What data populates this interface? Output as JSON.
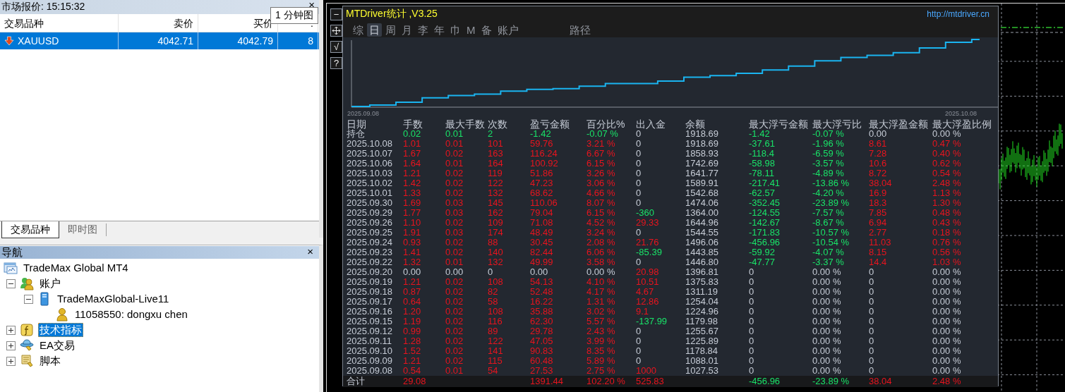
{
  "market_watch": {
    "title": "市场报价: 15:15:32",
    "close": "×",
    "tooltip": "1 分钟图",
    "columns": [
      "交易品种",
      "卖价",
      "买价",
      ":"
    ],
    "rows": [
      {
        "symbol": "XAUUSD",
        "price_down": true,
        "bid": "4042.71",
        "ask": "4042.79",
        "column_4": "8",
        "selected": true
      }
    ],
    "tabs": [
      {
        "label": "交易品种",
        "selected": true
      },
      {
        "label": "即时图",
        "selected": false
      }
    ]
  },
  "navigator": {
    "title": "导航",
    "close": "×",
    "tree": [
      {
        "label": "TradeMax Global MT4",
        "kind": "terminal",
        "selected": false,
        "children": [
          {
            "label": "账户",
            "kind": "accounts",
            "expanded": true,
            "selected": false,
            "children": [
              {
                "label": "TradeMaxGlobal-Live11",
                "kind": "server",
                "expanded": true,
                "selected": false,
                "children": [
                  {
                    "label": "11058550: dongxu chen",
                    "kind": "account",
                    "selected": false
                  }
                ]
              }
            ]
          },
          {
            "label": "技术指标",
            "kind": "indicators",
            "expanded": false,
            "selected": true
          },
          {
            "label": "EA交易",
            "kind": "experts",
            "expanded": false,
            "selected": false
          },
          {
            "label": "脚本",
            "kind": "scripts",
            "expanded": false,
            "selected": false
          }
        ]
      }
    ]
  },
  "chart_window": {
    "toolbar": [
      {
        "kind": "glyph",
        "label": "−"
      },
      {
        "kind": "move"
      },
      {
        "kind": "glyph",
        "label": "√"
      },
      {
        "kind": "glyph",
        "label": "?"
      }
    ]
  },
  "stats_panel": {
    "title": "MTDriver统计 ,V3.25",
    "link": "http://mtdriver.cn",
    "tabs": [
      {
        "label": "综",
        "selected": false
      },
      {
        "label": "日",
        "selected": true
      },
      {
        "label": "周",
        "selected": false
      },
      {
        "label": "月",
        "selected": false
      },
      {
        "label": "李",
        "selected": false
      },
      {
        "label": "年",
        "selected": false
      },
      {
        "label": "巾",
        "selected": false
      },
      {
        "label": "M",
        "selected": false
      },
      {
        "label": "备",
        "selected": false
      },
      {
        "label": "账户",
        "selected": false
      },
      {
        "label": "路径",
        "selected": false
      }
    ],
    "chart": {
      "start_label": "2025.09.08",
      "end_label": "2025.10.08"
    },
    "table": {
      "columns": [
        "日期",
        "手数",
        "最大手数",
        "次数",
        "盈亏金额",
        "百分比%",
        "出入金",
        "余额",
        "最大浮亏金额",
        "最大浮亏比",
        "最大浮盈金额",
        "最大浮盈比例"
      ],
      "rows": [
        {
          "cells": [
            {
              "text": "持仓",
              "color": "#c6ccd6"
            },
            {
              "text": "0.02",
              "color": "#19e368"
            },
            {
              "text": "0.01",
              "color": "#19e368"
            },
            {
              "text": "2",
              "color": "#19e368"
            },
            {
              "text": "-1.42",
              "color": "#19e368"
            },
            {
              "text": "-0.07 %",
              "color": "#19e368"
            },
            {
              "text": "0",
              "color": "#c6ccd6"
            },
            {
              "text": "1918.69",
              "color": "#c6ccd6"
            },
            {
              "text": "-1.42",
              "color": "#19e368"
            },
            {
              "text": "-0.07 %",
              "color": "#19e368"
            },
            {
              "text": "0.00",
              "color": "#c6ccd6"
            },
            {
              "text": "0.00 %",
              "color": "#c6ccd6"
            }
          ]
        },
        {
          "cells": [
            {
              "text": "2025.10.08",
              "color": "#c6ccd6"
            },
            {
              "text": "1.01",
              "color": "#e8141e"
            },
            {
              "text": "0.01",
              "color": "#e8141e"
            },
            {
              "text": "101",
              "color": "#e8141e"
            },
            {
              "text": "59.76",
              "color": "#e8141e"
            },
            {
              "text": "3.21 %",
              "color": "#e8141e"
            },
            {
              "text": "0",
              "color": "#c6ccd6"
            },
            {
              "text": "1918.69",
              "color": "#c6ccd6"
            },
            {
              "text": "-37.61",
              "color": "#19e368"
            },
            {
              "text": "-1.96 %",
              "color": "#19e368"
            },
            {
              "text": "8.61",
              "color": "#e8141e"
            },
            {
              "text": "0.47 %",
              "color": "#e8141e"
            }
          ]
        },
        {
          "cells": [
            {
              "text": "2025.10.07",
              "color": "#c6ccd6"
            },
            {
              "text": "1.67",
              "color": "#e8141e"
            },
            {
              "text": "0.02",
              "color": "#e8141e"
            },
            {
              "text": "163",
              "color": "#e8141e"
            },
            {
              "text": "116.24",
              "color": "#e8141e"
            },
            {
              "text": "6.67 %",
              "color": "#e8141e"
            },
            {
              "text": "0",
              "color": "#c6ccd6"
            },
            {
              "text": "1858.93",
              "color": "#c6ccd6"
            },
            {
              "text": "-118.4",
              "color": "#19e368"
            },
            {
              "text": "-6.59 %",
              "color": "#19e368"
            },
            {
              "text": "7.28",
              "color": "#e8141e"
            },
            {
              "text": "0.40 %",
              "color": "#e8141e"
            }
          ]
        },
        {
          "cells": [
            {
              "text": "2025.10.06",
              "color": "#c6ccd6"
            },
            {
              "text": "1.64",
              "color": "#e8141e"
            },
            {
              "text": "0.01",
              "color": "#e8141e"
            },
            {
              "text": "164",
              "color": "#e8141e"
            },
            {
              "text": "100.92",
              "color": "#e8141e"
            },
            {
              "text": "6.15 %",
              "color": "#e8141e"
            },
            {
              "text": "0",
              "color": "#c6ccd6"
            },
            {
              "text": "1742.69",
              "color": "#c6ccd6"
            },
            {
              "text": "-58.98",
              "color": "#19e368"
            },
            {
              "text": "-3.57 %",
              "color": "#19e368"
            },
            {
              "text": "10.6",
              "color": "#e8141e"
            },
            {
              "text": "0.62 %",
              "color": "#e8141e"
            }
          ]
        },
        {
          "cells": [
            {
              "text": "2025.10.03",
              "color": "#c6ccd6"
            },
            {
              "text": "1.21",
              "color": "#e8141e"
            },
            {
              "text": "0.02",
              "color": "#e8141e"
            },
            {
              "text": "119",
              "color": "#e8141e"
            },
            {
              "text": "51.86",
              "color": "#e8141e"
            },
            {
              "text": "3.26 %",
              "color": "#e8141e"
            },
            {
              "text": "0",
              "color": "#c6ccd6"
            },
            {
              "text": "1641.77",
              "color": "#c6ccd6"
            },
            {
              "text": "-78.11",
              "color": "#19e368"
            },
            {
              "text": "-4.89 %",
              "color": "#19e368"
            },
            {
              "text": "8.72",
              "color": "#e8141e"
            },
            {
              "text": "0.54 %",
              "color": "#e8141e"
            }
          ]
        },
        {
          "cells": [
            {
              "text": "2025.10.02",
              "color": "#c6ccd6"
            },
            {
              "text": "1.42",
              "color": "#e8141e"
            },
            {
              "text": "0.02",
              "color": "#e8141e"
            },
            {
              "text": "122",
              "color": "#e8141e"
            },
            {
              "text": "47.23",
              "color": "#e8141e"
            },
            {
              "text": "3.06 %",
              "color": "#e8141e"
            },
            {
              "text": "0",
              "color": "#c6ccd6"
            },
            {
              "text": "1589.91",
              "color": "#c6ccd6"
            },
            {
              "text": "-217.41",
              "color": "#19e368"
            },
            {
              "text": "-13.86 %",
              "color": "#19e368"
            },
            {
              "text": "38.04",
              "color": "#e8141e"
            },
            {
              "text": "2.48 %",
              "color": "#e8141e"
            }
          ]
        },
        {
          "cells": [
            {
              "text": "2025.10.01",
              "color": "#c6ccd6"
            },
            {
              "text": "1.33",
              "color": "#e8141e"
            },
            {
              "text": "0.02",
              "color": "#e8141e"
            },
            {
              "text": "132",
              "color": "#e8141e"
            },
            {
              "text": "68.62",
              "color": "#e8141e"
            },
            {
              "text": "4.66 %",
              "color": "#e8141e"
            },
            {
              "text": "0",
              "color": "#c6ccd6"
            },
            {
              "text": "1542.68",
              "color": "#c6ccd6"
            },
            {
              "text": "-62.57",
              "color": "#19e368"
            },
            {
              "text": "-4.20 %",
              "color": "#19e368"
            },
            {
              "text": "16.9",
              "color": "#e8141e"
            },
            {
              "text": "1.13 %",
              "color": "#e8141e"
            }
          ]
        },
        {
          "cells": [
            {
              "text": "2025.09.30",
              "color": "#c6ccd6"
            },
            {
              "text": "1.69",
              "color": "#e8141e"
            },
            {
              "text": "0.03",
              "color": "#e8141e"
            },
            {
              "text": "145",
              "color": "#e8141e"
            },
            {
              "text": "110.06",
              "color": "#e8141e"
            },
            {
              "text": "8.07 %",
              "color": "#e8141e"
            },
            {
              "text": "0",
              "color": "#c6ccd6"
            },
            {
              "text": "1474.06",
              "color": "#c6ccd6"
            },
            {
              "text": "-352.45",
              "color": "#19e368"
            },
            {
              "text": "-23.89 %",
              "color": "#19e368"
            },
            {
              "text": "18.3",
              "color": "#e8141e"
            },
            {
              "text": "1.30 %",
              "color": "#e8141e"
            }
          ]
        },
        {
          "cells": [
            {
              "text": "2025.09.29",
              "color": "#c6ccd6"
            },
            {
              "text": "1.77",
              "color": "#e8141e"
            },
            {
              "text": "0.03",
              "color": "#e8141e"
            },
            {
              "text": "162",
              "color": "#e8141e"
            },
            {
              "text": "79.04",
              "color": "#e8141e"
            },
            {
              "text": "6.15 %",
              "color": "#e8141e"
            },
            {
              "text": "-360",
              "color": "#19e368"
            },
            {
              "text": "1364.00",
              "color": "#c6ccd6"
            },
            {
              "text": "-124.55",
              "color": "#19e368"
            },
            {
              "text": "-7.57 %",
              "color": "#19e368"
            },
            {
              "text": "7.85",
              "color": "#e8141e"
            },
            {
              "text": "0.48 %",
              "color": "#e8141e"
            }
          ]
        },
        {
          "cells": [
            {
              "text": "2025.09.26",
              "color": "#c6ccd6"
            },
            {
              "text": "1.10",
              "color": "#e8141e"
            },
            {
              "text": "0.02",
              "color": "#e8141e"
            },
            {
              "text": "109",
              "color": "#e8141e"
            },
            {
              "text": "71.08",
              "color": "#e8141e"
            },
            {
              "text": "4.52 %",
              "color": "#e8141e"
            },
            {
              "text": "29.33",
              "color": "#e8141e"
            },
            {
              "text": "1644.96",
              "color": "#c6ccd6"
            },
            {
              "text": "-142.67",
              "color": "#19e368"
            },
            {
              "text": "-8.67 %",
              "color": "#19e368"
            },
            {
              "text": "6.94",
              "color": "#e8141e"
            },
            {
              "text": "0.43 %",
              "color": "#e8141e"
            }
          ]
        },
        {
          "cells": [
            {
              "text": "2025.09.25",
              "color": "#c6ccd6"
            },
            {
              "text": "1.91",
              "color": "#e8141e"
            },
            {
              "text": "0.03",
              "color": "#e8141e"
            },
            {
              "text": "174",
              "color": "#e8141e"
            },
            {
              "text": "48.49",
              "color": "#e8141e"
            },
            {
              "text": "3.24 %",
              "color": "#e8141e"
            },
            {
              "text": "0",
              "color": "#c6ccd6"
            },
            {
              "text": "1544.55",
              "color": "#c6ccd6"
            },
            {
              "text": "-171.83",
              "color": "#19e368"
            },
            {
              "text": "-10.57 %",
              "color": "#19e368"
            },
            {
              "text": "2.77",
              "color": "#e8141e"
            },
            {
              "text": "0.18 %",
              "color": "#e8141e"
            }
          ]
        },
        {
          "cells": [
            {
              "text": "2025.09.24",
              "color": "#c6ccd6"
            },
            {
              "text": "0.93",
              "color": "#e8141e"
            },
            {
              "text": "0.02",
              "color": "#e8141e"
            },
            {
              "text": "88",
              "color": "#e8141e"
            },
            {
              "text": "30.45",
              "color": "#e8141e"
            },
            {
              "text": "2.08 %",
              "color": "#e8141e"
            },
            {
              "text": "21.76",
              "color": "#e8141e"
            },
            {
              "text": "1496.06",
              "color": "#c6ccd6"
            },
            {
              "text": "-456.96",
              "color": "#19e368"
            },
            {
              "text": "-10.54 %",
              "color": "#19e368"
            },
            {
              "text": "11.03",
              "color": "#e8141e"
            },
            {
              "text": "0.76 %",
              "color": "#e8141e"
            }
          ]
        },
        {
          "cells": [
            {
              "text": "2025.09.23",
              "color": "#c6ccd6"
            },
            {
              "text": "1.41",
              "color": "#e8141e"
            },
            {
              "text": "0.02",
              "color": "#e8141e"
            },
            {
              "text": "140",
              "color": "#e8141e"
            },
            {
              "text": "82.44",
              "color": "#e8141e"
            },
            {
              "text": "6.06 %",
              "color": "#e8141e"
            },
            {
              "text": "-85.39",
              "color": "#19e368"
            },
            {
              "text": "1443.85",
              "color": "#c6ccd6"
            },
            {
              "text": "-59.92",
              "color": "#19e368"
            },
            {
              "text": "-4.07 %",
              "color": "#19e368"
            },
            {
              "text": "8.15",
              "color": "#e8141e"
            },
            {
              "text": "0.56 %",
              "color": "#e8141e"
            }
          ]
        },
        {
          "cells": [
            {
              "text": "2025.09.22",
              "color": "#c6ccd6"
            },
            {
              "text": "1.32",
              "color": "#e8141e"
            },
            {
              "text": "0.01",
              "color": "#e8141e"
            },
            {
              "text": "132",
              "color": "#e8141e"
            },
            {
              "text": "49.99",
              "color": "#e8141e"
            },
            {
              "text": "3.58 %",
              "color": "#e8141e"
            },
            {
              "text": "0",
              "color": "#c6ccd6"
            },
            {
              "text": "1446.80",
              "color": "#c6ccd6"
            },
            {
              "text": "-47.77",
              "color": "#19e368"
            },
            {
              "text": "-3.37 %",
              "color": "#19e368"
            },
            {
              "text": "14.4",
              "color": "#e8141e"
            },
            {
              "text": "1.03 %",
              "color": "#e8141e"
            }
          ]
        },
        {
          "cells": [
            {
              "text": "2025.09.20",
              "color": "#c6ccd6"
            },
            {
              "text": "0.00",
              "color": "#c6ccd6"
            },
            {
              "text": "0.00",
              "color": "#c6ccd6"
            },
            {
              "text": "0",
              "color": "#c6ccd6"
            },
            {
              "text": "0.00",
              "color": "#c6ccd6"
            },
            {
              "text": "0.00 %",
              "color": "#c6ccd6"
            },
            {
              "text": "20.98",
              "color": "#e8141e"
            },
            {
              "text": "1396.81",
              "color": "#c6ccd6"
            },
            {
              "text": "0",
              "color": "#c6ccd6"
            },
            {
              "text": "0.00 %",
              "color": "#c6ccd6"
            },
            {
              "text": "0",
              "color": "#c6ccd6"
            },
            {
              "text": "0.00 %",
              "color": "#c6ccd6"
            }
          ]
        },
        {
          "cells": [
            {
              "text": "2025.09.19",
              "color": "#c6ccd6"
            },
            {
              "text": "1.21",
              "color": "#e8141e"
            },
            {
              "text": "0.02",
              "color": "#e8141e"
            },
            {
              "text": "108",
              "color": "#e8141e"
            },
            {
              "text": "54.13",
              "color": "#e8141e"
            },
            {
              "text": "4.10 %",
              "color": "#e8141e"
            },
            {
              "text": "10.51",
              "color": "#e8141e"
            },
            {
              "text": "1375.83",
              "color": "#c6ccd6"
            },
            {
              "text": "0",
              "color": "#c6ccd6"
            },
            {
              "text": "0.00 %",
              "color": "#c6ccd6"
            },
            {
              "text": "0",
              "color": "#c6ccd6"
            },
            {
              "text": "0.00 %",
              "color": "#c6ccd6"
            }
          ]
        },
        {
          "cells": [
            {
              "text": "2025.09.18",
              "color": "#c6ccd6"
            },
            {
              "text": "0.87",
              "color": "#e8141e"
            },
            {
              "text": "0.02",
              "color": "#e8141e"
            },
            {
              "text": "82",
              "color": "#e8141e"
            },
            {
              "text": "52.48",
              "color": "#e8141e"
            },
            {
              "text": "4.17 %",
              "color": "#e8141e"
            },
            {
              "text": "4.67",
              "color": "#e8141e"
            },
            {
              "text": "1311.19",
              "color": "#c6ccd6"
            },
            {
              "text": "0",
              "color": "#c6ccd6"
            },
            {
              "text": "0.00 %",
              "color": "#c6ccd6"
            },
            {
              "text": "0",
              "color": "#c6ccd6"
            },
            {
              "text": "0.00 %",
              "color": "#c6ccd6"
            }
          ]
        },
        {
          "cells": [
            {
              "text": "2025.09.17",
              "color": "#c6ccd6"
            },
            {
              "text": "0.64",
              "color": "#e8141e"
            },
            {
              "text": "0.02",
              "color": "#e8141e"
            },
            {
              "text": "58",
              "color": "#e8141e"
            },
            {
              "text": "16.22",
              "color": "#e8141e"
            },
            {
              "text": "1.31 %",
              "color": "#e8141e"
            },
            {
              "text": "12.86",
              "color": "#e8141e"
            },
            {
              "text": "1254.04",
              "color": "#c6ccd6"
            },
            {
              "text": "0",
              "color": "#c6ccd6"
            },
            {
              "text": "0.00 %",
              "color": "#c6ccd6"
            },
            {
              "text": "0",
              "color": "#c6ccd6"
            },
            {
              "text": "0.00 %",
              "color": "#c6ccd6"
            }
          ]
        },
        {
          "cells": [
            {
              "text": "2025.09.16",
              "color": "#c6ccd6"
            },
            {
              "text": "1.20",
              "color": "#e8141e"
            },
            {
              "text": "0.02",
              "color": "#e8141e"
            },
            {
              "text": "108",
              "color": "#e8141e"
            },
            {
              "text": "35.88",
              "color": "#e8141e"
            },
            {
              "text": "3.02 %",
              "color": "#e8141e"
            },
            {
              "text": "9.1",
              "color": "#e8141e"
            },
            {
              "text": "1224.96",
              "color": "#c6ccd6"
            },
            {
              "text": "0",
              "color": "#c6ccd6"
            },
            {
              "text": "0.00 %",
              "color": "#c6ccd6"
            },
            {
              "text": "0",
              "color": "#c6ccd6"
            },
            {
              "text": "0.00 %",
              "color": "#c6ccd6"
            }
          ]
        },
        {
          "cells": [
            {
              "text": "2025.09.15",
              "color": "#c6ccd6"
            },
            {
              "text": "1.19",
              "color": "#e8141e"
            },
            {
              "text": "0.02",
              "color": "#e8141e"
            },
            {
              "text": "116",
              "color": "#e8141e"
            },
            {
              "text": "62.30",
              "color": "#e8141e"
            },
            {
              "text": "5.57 %",
              "color": "#e8141e"
            },
            {
              "text": "-137.99",
              "color": "#19e368"
            },
            {
              "text": "1179.98",
              "color": "#c6ccd6"
            },
            {
              "text": "0",
              "color": "#c6ccd6"
            },
            {
              "text": "0.00 %",
              "color": "#c6ccd6"
            },
            {
              "text": "0",
              "color": "#c6ccd6"
            },
            {
              "text": "0.00 %",
              "color": "#c6ccd6"
            }
          ]
        },
        {
          "cells": [
            {
              "text": "2025.09.12",
              "color": "#c6ccd6"
            },
            {
              "text": "0.99",
              "color": "#e8141e"
            },
            {
              "text": "0.02",
              "color": "#e8141e"
            },
            {
              "text": "89",
              "color": "#e8141e"
            },
            {
              "text": "29.78",
              "color": "#e8141e"
            },
            {
              "text": "2.43 %",
              "color": "#e8141e"
            },
            {
              "text": "0",
              "color": "#c6ccd6"
            },
            {
              "text": "1255.67",
              "color": "#c6ccd6"
            },
            {
              "text": "0",
              "color": "#c6ccd6"
            },
            {
              "text": "0.00 %",
              "color": "#c6ccd6"
            },
            {
              "text": "0",
              "color": "#c6ccd6"
            },
            {
              "text": "0.00 %",
              "color": "#c6ccd6"
            }
          ]
        },
        {
          "cells": [
            {
              "text": "2025.09.11",
              "color": "#c6ccd6"
            },
            {
              "text": "1.28",
              "color": "#e8141e"
            },
            {
              "text": "0.02",
              "color": "#e8141e"
            },
            {
              "text": "122",
              "color": "#e8141e"
            },
            {
              "text": "47.05",
              "color": "#e8141e"
            },
            {
              "text": "3.99 %",
              "color": "#e8141e"
            },
            {
              "text": "0",
              "color": "#c6ccd6"
            },
            {
              "text": "1225.89",
              "color": "#c6ccd6"
            },
            {
              "text": "0",
              "color": "#c6ccd6"
            },
            {
              "text": "0.00 %",
              "color": "#c6ccd6"
            },
            {
              "text": "0",
              "color": "#c6ccd6"
            },
            {
              "text": "0.00 %",
              "color": "#c6ccd6"
            }
          ]
        },
        {
          "cells": [
            {
              "text": "2025.09.10",
              "color": "#c6ccd6"
            },
            {
              "text": "1.52",
              "color": "#e8141e"
            },
            {
              "text": "0.02",
              "color": "#e8141e"
            },
            {
              "text": "141",
              "color": "#e8141e"
            },
            {
              "text": "90.83",
              "color": "#e8141e"
            },
            {
              "text": "8.35 %",
              "color": "#e8141e"
            },
            {
              "text": "0",
              "color": "#c6ccd6"
            },
            {
              "text": "1178.84",
              "color": "#c6ccd6"
            },
            {
              "text": "0",
              "color": "#c6ccd6"
            },
            {
              "text": "0.00 %",
              "color": "#c6ccd6"
            },
            {
              "text": "0",
              "color": "#c6ccd6"
            },
            {
              "text": "0.00 %",
              "color": "#c6ccd6"
            }
          ]
        },
        {
          "cells": [
            {
              "text": "2025.09.09",
              "color": "#c6ccd6"
            },
            {
              "text": "1.21",
              "color": "#e8141e"
            },
            {
              "text": "0.02",
              "color": "#e8141e"
            },
            {
              "text": "115",
              "color": "#e8141e"
            },
            {
              "text": "60.48",
              "color": "#e8141e"
            },
            {
              "text": "5.89 %",
              "color": "#e8141e"
            },
            {
              "text": "0",
              "color": "#c6ccd6"
            },
            {
              "text": "1088.01",
              "color": "#c6ccd6"
            },
            {
              "text": "0",
              "color": "#c6ccd6"
            },
            {
              "text": "0.00 %",
              "color": "#c6ccd6"
            },
            {
              "text": "0",
              "color": "#c6ccd6"
            },
            {
              "text": "0.00 %",
              "color": "#c6ccd6"
            }
          ]
        },
        {
          "cells": [
            {
              "text": "2025.09.08",
              "color": "#c6ccd6"
            },
            {
              "text": "0.54",
              "color": "#e8141e"
            },
            {
              "text": "0.01",
              "color": "#e8141e"
            },
            {
              "text": "54",
              "color": "#e8141e"
            },
            {
              "text": "27.53",
              "color": "#e8141e"
            },
            {
              "text": "2.75 %",
              "color": "#e8141e"
            },
            {
              "text": "1000",
              "color": "#e8141e"
            },
            {
              "text": "1027.53",
              "color": "#c6ccd6"
            },
            {
              "text": "0",
              "color": "#c6ccd6"
            },
            {
              "text": "0.00 %",
              "color": "#c6ccd6"
            },
            {
              "text": "0",
              "color": "#c6ccd6"
            },
            {
              "text": "0.00 %",
              "color": "#c6ccd6"
            }
          ]
        }
      ],
      "total": {
        "cells": [
          {
            "text": "合计",
            "color": "#c6ccd6"
          },
          {
            "text": "29.08",
            "color": "#e8141e"
          },
          null,
          null,
          {
            "text": "1391.44",
            "color": "#e8141e"
          },
          {
            "text": "102.20 %",
            "color": "#e8141e"
          },
          {
            "text": "525.83",
            "color": "#e8141e"
          },
          null,
          {
            "text": "-456.96",
            "color": "#19e368"
          },
          {
            "text": "-23.89 %",
            "color": "#19e368"
          },
          {
            "text": "38.04",
            "color": "#e8141e"
          },
          {
            "text": "2.48 %",
            "color": "#e8141e"
          }
        ]
      }
    }
  }
}
